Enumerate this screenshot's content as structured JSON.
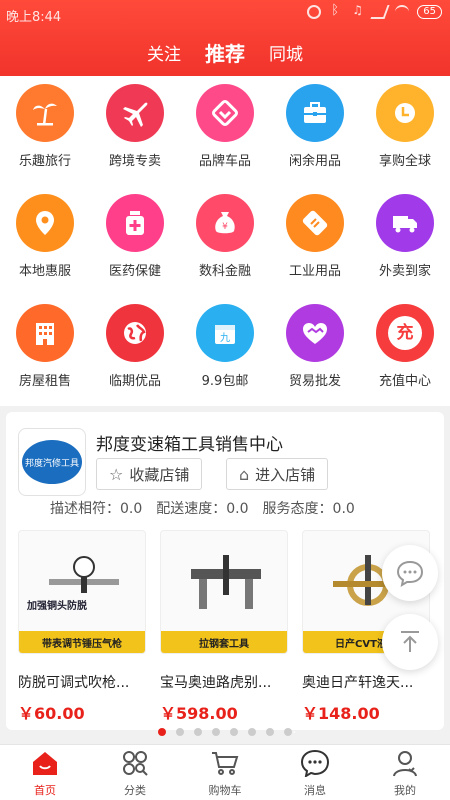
{
  "status_bar": {
    "time": "晚上8:44",
    "battery": "65"
  },
  "header": {
    "tabs": [
      {
        "label": "关注"
      },
      {
        "label": "推荐"
      },
      {
        "label": "同城"
      }
    ]
  },
  "categories": [
    {
      "label": "乐趣旅行",
      "icon": "palm-tree-icon",
      "color": "#ff7a2e"
    },
    {
      "label": "跨境专卖",
      "icon": "airplane-icon",
      "color": "#f03a55"
    },
    {
      "label": "品牌车品",
      "icon": "heart-check-icon",
      "color": "#ff4a8a"
    },
    {
      "label": "闲余用品",
      "icon": "toolbox-icon",
      "color": "#2aa3ef"
    },
    {
      "label": "享购全球",
      "icon": "clock-icon",
      "color": "#ffb32c"
    },
    {
      "label": "本地惠服",
      "icon": "location-pin-icon",
      "color": "#ff8f1c"
    },
    {
      "label": "医药保健",
      "icon": "medicine-bottle-icon",
      "color": "#ff3f8a"
    },
    {
      "label": "数科金融",
      "icon": "money-bag-icon",
      "color": "#ff4a6a"
    },
    {
      "label": "工业用品",
      "icon": "ticket-icon",
      "color": "#ff8a1f"
    },
    {
      "label": "外卖到家",
      "icon": "delivery-truck-icon",
      "color": "#a13ae8"
    },
    {
      "label": "房屋租售",
      "icon": "building-icon",
      "color": "#ff6a2a"
    },
    {
      "label": "临期优品",
      "icon": "globe-icon",
      "color": "#f0343e"
    },
    {
      "label": "9.9包邮",
      "icon": "package-icon",
      "color": "#2ab0f0"
    },
    {
      "label": "贸易批发",
      "icon": "handshake-heart-icon",
      "color": "#b03be0"
    },
    {
      "label": "充值中心",
      "icon": "recharge-icon",
      "color": "#f63c3c",
      "glyph": "充"
    }
  ],
  "shop": {
    "name": "邦度变速箱工具销售中心",
    "logo_text": "邦度汽修工具",
    "favorite_label": "收藏店铺",
    "enter_label": "进入店铺",
    "ratings": [
      {
        "label": "描述相符：0.0"
      },
      {
        "label": "配送速度：0.0"
      },
      {
        "label": "服务态度：0.0"
      }
    ],
    "products": [
      {
        "name": "防脱可调式吹枪...",
        "price": "￥60.00",
        "image_caption": "加强铜头防脱",
        "image_band": "带表调节锤压气枪"
      },
      {
        "name": "宝马奥迪路虎别...",
        "price": "￥598.00",
        "image_caption": "",
        "image_band": "拉钢套工具"
      },
      {
        "name": "奥迪日产轩逸天...",
        "price": "￥148.00",
        "image_caption": "",
        "image_band": "日产CVT液压"
      }
    ]
  },
  "bottom_nav": [
    {
      "label": "首页",
      "icon": "home-icon"
    },
    {
      "label": "分类",
      "icon": "category-icon"
    },
    {
      "label": "购物车",
      "icon": "cart-icon"
    },
    {
      "label": "消息",
      "icon": "message-icon"
    },
    {
      "label": "我的",
      "icon": "profile-icon"
    }
  ],
  "colors": {
    "brand": "#f1332c",
    "price": "#e8221b"
  }
}
